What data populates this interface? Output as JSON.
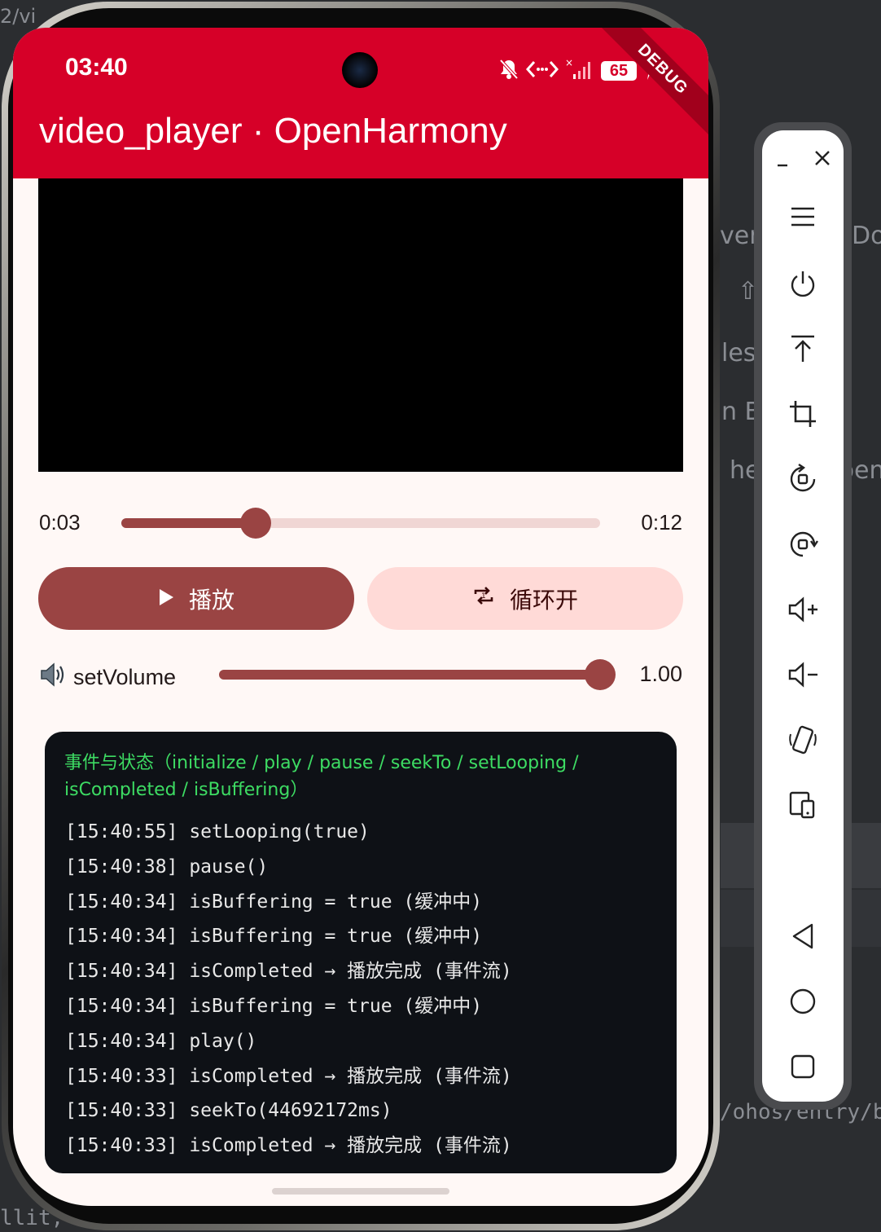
{
  "background": {
    "fragments": [
      "2/vi",
      "very",
      "Do",
      "les",
      "n B",
      "hel",
      "pen",
      "/ohos/entry/b",
      "llit,"
    ]
  },
  "status_bar": {
    "time": "03:40",
    "battery": "65",
    "debug_banner": "DEBUG"
  },
  "app_bar": {
    "title": "video_player · OpenHarmony"
  },
  "player": {
    "position": "0:03",
    "duration": "0:12",
    "progress_fraction": 0.28,
    "play_label": "播放",
    "loop_label": "循环开",
    "volume_label": "setVolume",
    "volume_value": "1.00",
    "volume_fraction": 1.0
  },
  "log": {
    "header": "事件与状态（initialize / play / pause / seekTo / setLooping / isCompleted / isBuffering）",
    "entries": [
      "[15:40:55] setLooping(true)",
      "[15:40:38] pause()",
      "[15:40:34] isBuffering = true (缓冲中)",
      "[15:40:34] isBuffering = true (缓冲中)",
      "[15:40:34] isCompleted → 播放完成 (事件流)",
      "[15:40:34] isBuffering = true (缓冲中)",
      "[15:40:34] play()",
      "[15:40:33] isCompleted → 播放完成 (事件流)",
      "[15:40:33] seekTo(44692172ms)",
      "[15:40:33] isCompleted → 播放完成 (事件流)"
    ]
  },
  "colors": {
    "app_bar": "#d60028",
    "primary": "#9a4443",
    "secondary_container": "#ffdad7",
    "log_bg": "#0e1116",
    "log_header": "#3ddc63"
  },
  "toolbar": {
    "icons": [
      "minimize-icon",
      "close-icon",
      "menu-icon",
      "power-icon",
      "upload-icon",
      "crop-icon",
      "rotate-left-icon",
      "rotate-right-icon",
      "volume-up-icon",
      "volume-down-icon",
      "shake-icon",
      "fold-icon",
      "back-icon",
      "home-icon",
      "recents-icon"
    ]
  }
}
